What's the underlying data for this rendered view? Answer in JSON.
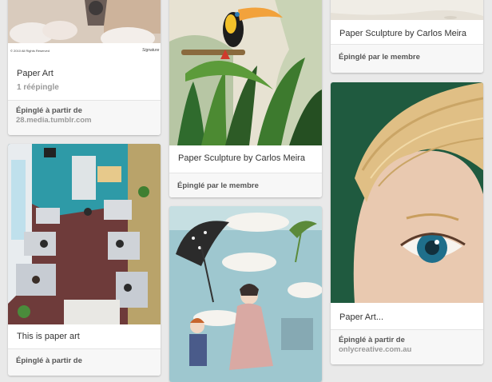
{
  "pins": [
    {
      "description": "Paper Art",
      "repins": "1 réépingle",
      "attribution": "Épinglé à partir de",
      "source": "28.media.tumblr.com"
    },
    {
      "description": "Paper Sculpture by Carlos Meira",
      "attribution": "Épinglé par le membre"
    },
    {
      "description": "Paper Sculpture by Carlos Meira",
      "attribution": "Épinglé par le membre"
    },
    {
      "description": "This is paper art",
      "attribution": "Épinglé à partir de"
    },
    {
      "description": "Paper Art...",
      "attribution": "Épinglé à partir de",
      "source": "onlycreative.com.au"
    }
  ],
  "colors": {
    "background": "#e9e9e9",
    "card": "#ffffff",
    "footer": "#f7f7f7",
    "muted_text": "#999999"
  }
}
